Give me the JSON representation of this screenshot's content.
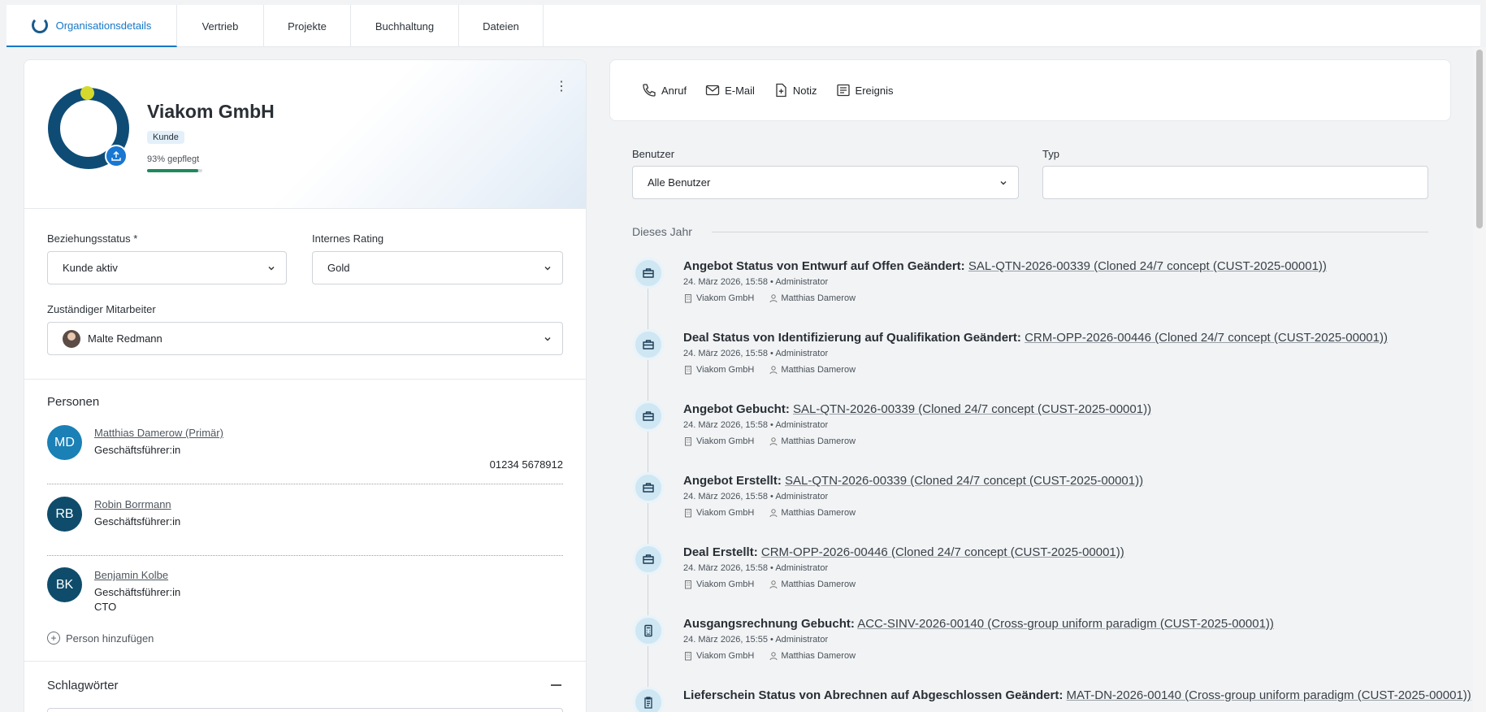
{
  "tabs": [
    "Organisationsdetails",
    "Vertrieb",
    "Projekte",
    "Buchhaltung",
    "Dateien"
  ],
  "org": {
    "name": "Viakom GmbH",
    "badge": "Kunde",
    "care_text": "93% gepflegt",
    "care_fraction": 0.93
  },
  "fields": {
    "relationship_label": "Beziehungsstatus *",
    "relationship_value": "Kunde aktiv",
    "rating_label": "Internes Rating",
    "rating_value": "Gold",
    "owner_label": "Zuständiger Mitarbeiter",
    "owner_value": "Malte Redmann"
  },
  "persons": {
    "title": "Personen",
    "items": [
      {
        "initials": "MD",
        "name": "Matthias Damerow (Primär)",
        "role": "Geschäftsführer:in",
        "phone": "01234 5678912",
        "color": "#1a80b6"
      },
      {
        "initials": "RB",
        "name": "Robin Borrmann",
        "role": "Geschäftsführer:in",
        "color": "#0f4c6b"
      },
      {
        "initials": "BK",
        "name": "Benjamin Kolbe",
        "role": "Geschäftsführer:in",
        "role2": "CTO",
        "color": "#0f4c6b"
      }
    ],
    "add_label": "Person hinzufügen"
  },
  "tags": {
    "title": "Schlagwörter"
  },
  "actions": [
    "Anruf",
    "E-Mail",
    "Notiz",
    "Ereignis"
  ],
  "filters": {
    "user_label": "Benutzer",
    "user_value": "Alle Benutzer",
    "type_label": "Typ",
    "type_value": ""
  },
  "timeline": {
    "year_label": "Dieses Jahr",
    "entries": [
      {
        "icon": "briefcase-icon",
        "title": "Angebot Status von Entwurf auf Offen Geändert:",
        "link": "SAL-QTN-2026-00339 (Cloned 24/7 concept (CUST-2025-00001))",
        "meta": "24. März 2026, 15:58 • Administrator",
        "org": "Viakom GmbH",
        "person": "Matthias Damerow"
      },
      {
        "icon": "briefcase-icon",
        "title": "Deal Status von Identifizierung auf Qualifikation Geändert:",
        "link": "CRM-OPP-2026-00446 (Cloned 24/7 concept (CUST-2025-00001))",
        "meta": "24. März 2026, 15:58 • Administrator",
        "org": "Viakom GmbH",
        "person": "Matthias Damerow"
      },
      {
        "icon": "briefcase-icon",
        "title": "Angebot Gebucht:",
        "link": "SAL-QTN-2026-00339 (Cloned 24/7 concept (CUST-2025-00001))",
        "meta": "24. März 2026, 15:58 • Administrator",
        "org": "Viakom GmbH",
        "person": "Matthias Damerow"
      },
      {
        "icon": "briefcase-icon",
        "title": "Angebot Erstellt:",
        "link": "SAL-QTN-2026-00339 (Cloned 24/7 concept (CUST-2025-00001))",
        "meta": "24. März 2026, 15:58 • Administrator",
        "org": "Viakom GmbH",
        "person": "Matthias Damerow"
      },
      {
        "icon": "briefcase-icon",
        "title": "Deal Erstellt:",
        "link": "CRM-OPP-2026-00446 (Cloned 24/7 concept (CUST-2025-00001))",
        "meta": "24. März 2026, 15:58 • Administrator",
        "org": "Viakom GmbH",
        "person": "Matthias Damerow"
      },
      {
        "icon": "calculator-icon",
        "title": "Ausgangsrechnung Gebucht:",
        "link": "ACC-SINV-2026-00140 (Cross-group uniform paradigm (CUST-2025-00001))",
        "meta": "24. März 2026, 15:55 • Administrator",
        "org": "Viakom GmbH",
        "person": "Matthias Damerow"
      },
      {
        "icon": "clipboard-icon",
        "title": "Lieferschein Status von Abrechnen auf Abgeschlossen Geändert:",
        "link": "MAT-DN-2026-00140 (Cross-group uniform paradigm (CUST-2025-00001))",
        "meta": "",
        "org": "",
        "person": ""
      }
    ]
  }
}
